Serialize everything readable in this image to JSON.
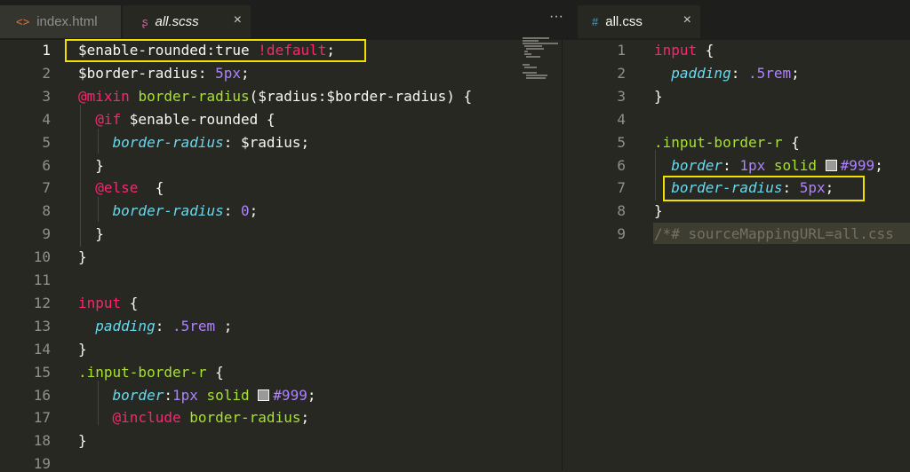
{
  "tabs_left": [
    {
      "label": "index.html",
      "icon": "code-file-icon",
      "icon_glyph": "<>",
      "active": false
    },
    {
      "label": "all.scss",
      "icon": "scss-file-icon",
      "icon_glyph": "ʂ",
      "active": true,
      "close": "×"
    }
  ],
  "more_menu": "···",
  "tabs_right": [
    {
      "label": "all.css",
      "icon": "css-file-icon",
      "icon_glyph": "#",
      "active": true,
      "close": "×"
    }
  ],
  "left_editor": {
    "line_numbers": [
      "1",
      "2",
      "3",
      "4",
      "5",
      "6",
      "7",
      "8",
      "9",
      "10",
      "11",
      "12",
      "13",
      "14",
      "15",
      "16",
      "17",
      "18",
      "19"
    ],
    "current_line": 1,
    "lines": [
      [
        [
          "var",
          "$enable-rounded:true "
        ],
        [
          "kw",
          "!default"
        ],
        [
          "punc",
          ";"
        ]
      ],
      [
        [
          "var",
          "$border-radius: "
        ],
        [
          "num",
          "5px"
        ],
        [
          "punc",
          ";"
        ]
      ],
      [
        [
          "kw",
          "@mixin "
        ],
        [
          "fn",
          "border-radius"
        ],
        [
          "punc",
          "($radius:$border-radius) {"
        ]
      ],
      [
        [
          "punc",
          "  "
        ],
        [
          "kw",
          "@if "
        ],
        [
          "var",
          "$enable-rounded {"
        ]
      ],
      [
        [
          "punc",
          "    "
        ],
        [
          "prop",
          "border-radius"
        ],
        [
          "punc",
          ": $radius;"
        ]
      ],
      [
        [
          "punc",
          "  }"
        ]
      ],
      [
        [
          "punc",
          "  "
        ],
        [
          "kw",
          "@else "
        ],
        [
          "punc",
          " {"
        ]
      ],
      [
        [
          "punc",
          "    "
        ],
        [
          "prop",
          "border-radius"
        ],
        [
          "punc",
          ": "
        ],
        [
          "num",
          "0"
        ],
        [
          "punc",
          ";"
        ]
      ],
      [
        [
          "punc",
          "  }"
        ]
      ],
      [
        [
          "punc",
          "}"
        ]
      ],
      [],
      [
        [
          "kw",
          "input"
        ],
        [
          "punc",
          " {"
        ]
      ],
      [
        [
          "punc",
          "  "
        ],
        [
          "prop",
          "padding"
        ],
        [
          "punc",
          ": "
        ],
        [
          "num",
          ".5rem"
        ],
        [
          "punc",
          " ;"
        ]
      ],
      [
        [
          "punc",
          "}"
        ]
      ],
      [
        [
          "sel",
          ".input-border-r"
        ],
        [
          "punc",
          " {"
        ]
      ],
      [
        [
          "punc",
          "    "
        ],
        [
          "prop",
          "border"
        ],
        [
          "punc",
          ":"
        ],
        [
          "num",
          "1px "
        ],
        [
          "fn",
          "solid "
        ],
        [
          "swatch",
          ""
        ],
        [
          "num",
          "#999"
        ],
        [
          "punc",
          ";"
        ]
      ],
      [
        [
          "punc",
          "    "
        ],
        [
          "kw",
          "@include "
        ],
        [
          "fn",
          "border-radius"
        ],
        [
          "punc",
          ";"
        ]
      ],
      [
        [
          "punc",
          "}"
        ]
      ],
      []
    ]
  },
  "right_editor": {
    "line_numbers": [
      "1",
      "2",
      "3",
      "4",
      "5",
      "6",
      "7",
      "8",
      "9"
    ],
    "lines": [
      [
        [
          "kw",
          "input"
        ],
        [
          "punc",
          " {"
        ]
      ],
      [
        [
          "punc",
          "  "
        ],
        [
          "prop",
          "padding"
        ],
        [
          "punc",
          ": "
        ],
        [
          "num",
          ".5rem"
        ],
        [
          "punc",
          ";"
        ]
      ],
      [
        [
          "punc",
          "}"
        ]
      ],
      [],
      [
        [
          "sel",
          ".input-border-r"
        ],
        [
          "punc",
          " {"
        ]
      ],
      [
        [
          "punc",
          "  "
        ],
        [
          "prop",
          "border"
        ],
        [
          "punc",
          ": "
        ],
        [
          "num",
          "1px "
        ],
        [
          "fn",
          "solid "
        ],
        [
          "swatch",
          ""
        ],
        [
          "num",
          "#999"
        ],
        [
          "punc",
          ";"
        ]
      ],
      [
        [
          "punc",
          "  "
        ],
        [
          "prop",
          "border-radius"
        ],
        [
          "punc",
          ": "
        ],
        [
          "num",
          "5px"
        ],
        [
          "punc",
          ";"
        ]
      ],
      [
        [
          "punc",
          "}"
        ]
      ],
      [
        [
          "com",
          "/*# sourceMappingURL=all.css"
        ]
      ]
    ]
  },
  "colors": {
    "background": "#272822",
    "highlight_box": "#f2e000",
    "keyword": "#f92672",
    "number": "#ae81ff",
    "function": "#a6e22e",
    "property": "#66d9ef"
  }
}
